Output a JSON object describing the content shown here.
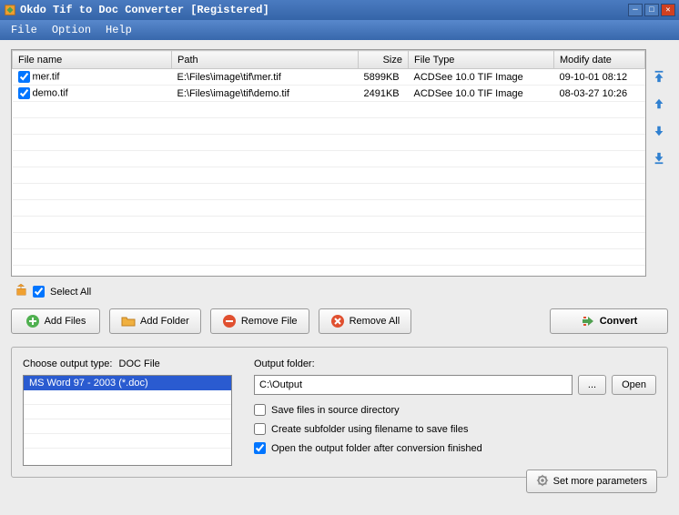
{
  "window": {
    "title": "Okdo Tif to Doc Converter [Registered]"
  },
  "menu": {
    "file": "File",
    "option": "Option",
    "help": "Help"
  },
  "table": {
    "headers": {
      "name": "File name",
      "path": "Path",
      "size": "Size",
      "type": "File Type",
      "modify": "Modify date"
    },
    "rows": [
      {
        "checked": true,
        "name": "mer.tif",
        "path": "E:\\Files\\image\\tif\\mer.tif",
        "size": "5899KB",
        "type": "ACDSee 10.0 TIF Image",
        "modify": "09-10-01 08:12"
      },
      {
        "checked": true,
        "name": "demo.tif",
        "path": "E:\\Files\\image\\tif\\demo.tif",
        "size": "2491KB",
        "type": "ACDSee 10.0 TIF Image",
        "modify": "08-03-27 10:26"
      }
    ]
  },
  "selectall": {
    "label": "Select All",
    "checked": true
  },
  "buttons": {
    "addFiles": "Add Files",
    "addFolder": "Add Folder",
    "removeFile": "Remove File",
    "removeAll": "Remove All",
    "convert": "Convert"
  },
  "output": {
    "typeLabel": "Choose output type:",
    "typeValue": "DOC File",
    "typeOption": "MS Word 97 - 2003 (*.doc)",
    "folderLabel": "Output folder:",
    "folderValue": "C:\\Output",
    "browse": "...",
    "open": "Open",
    "chk1": {
      "label": "Save files in source directory",
      "checked": false
    },
    "chk2": {
      "label": "Create subfolder using filename to save files",
      "checked": false
    },
    "chk3": {
      "label": "Open the output folder after conversion finished",
      "checked": true
    },
    "moreParams": "Set more parameters"
  },
  "colors": {
    "accent": "#3868ac",
    "select": "#2a5bd0"
  }
}
